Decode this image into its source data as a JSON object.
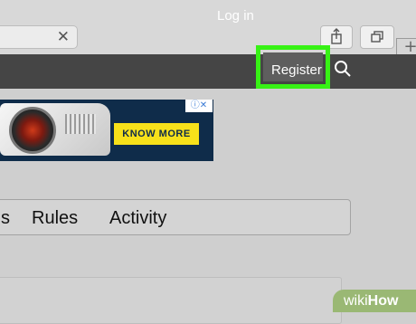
{
  "browser": {
    "close_glyph": "✕",
    "new_tab_glyph": "+",
    "icons": [
      "close-icon",
      "share-icon",
      "tabs-icon",
      "plus-icon"
    ]
  },
  "nav": {
    "login_label": "Log in",
    "register_label": "Register",
    "search_icon": "search-icon",
    "highlight_color": "#37f215"
  },
  "ad": {
    "cta_label": "KNOW MORE",
    "info_glyph": "ⓘ✕"
  },
  "tabs": {
    "partial_label": "s",
    "items": [
      {
        "label": "Rules"
      },
      {
        "label": "Activity"
      }
    ]
  },
  "watermark": {
    "wiki": "wiki",
    "how": "How"
  }
}
